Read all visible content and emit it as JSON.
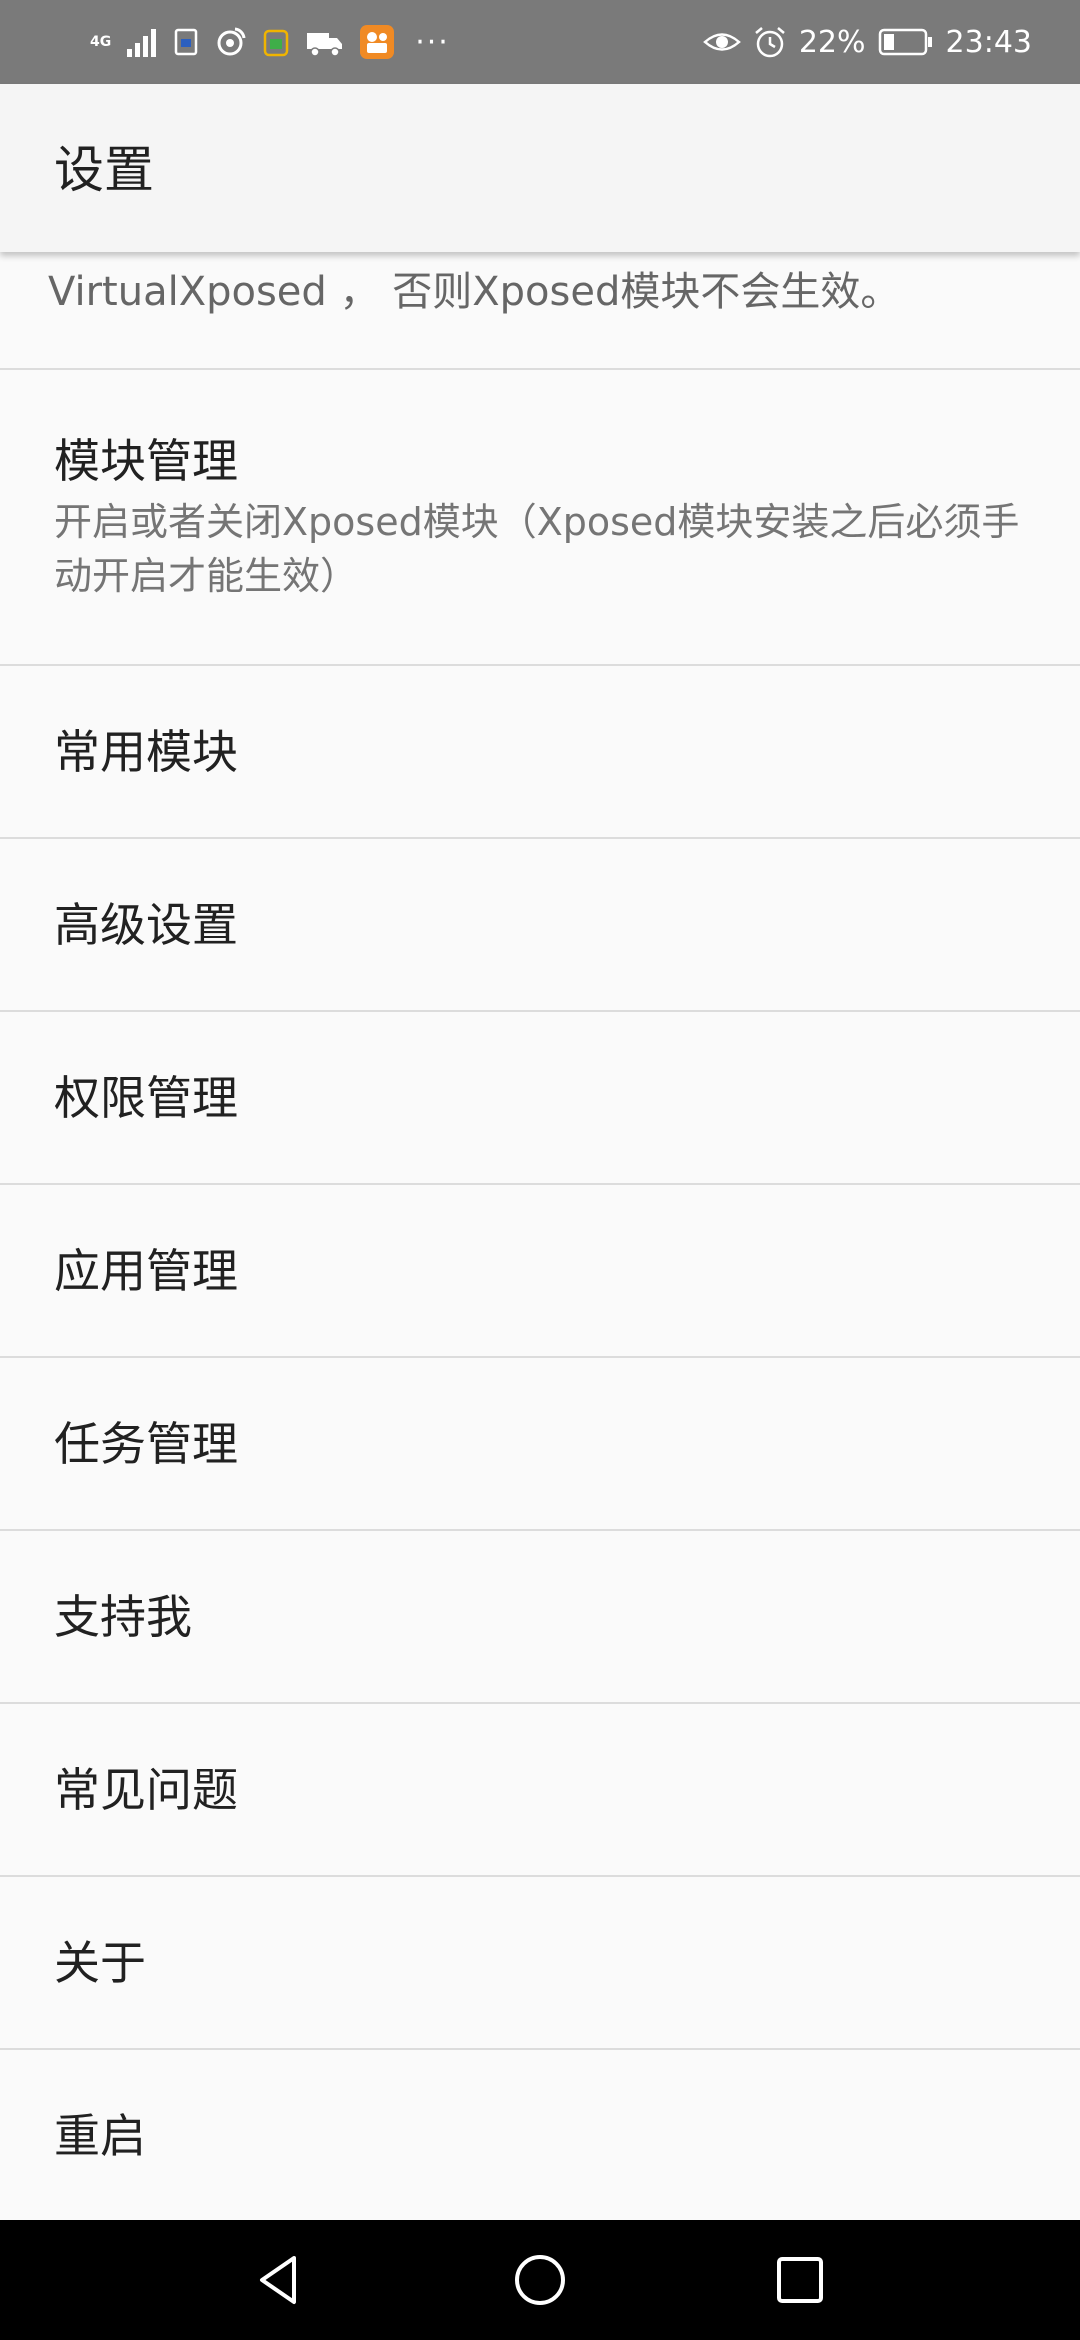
{
  "status_bar": {
    "network": "4G",
    "battery_percent": "22%",
    "time": "23:43",
    "more": "···",
    "left_icons": [
      "signal-icon",
      "sim-icon",
      "weibo-icon",
      "wechat-icon",
      "truck-icon",
      "video-app-icon"
    ],
    "right_icons": [
      "eye-icon",
      "alarm-icon",
      "battery-icon"
    ]
  },
  "app_bar": {
    "title": "设置"
  },
  "list": {
    "partial_item": {
      "summary": "VirtualXposed ， 否则Xposed模块不会生效。"
    },
    "items": [
      {
        "title": "模块管理",
        "summary": "开启或者关闭Xposed模块（Xposed模块安装之后必须手动开启才能生效）"
      },
      {
        "title": "常用模块"
      },
      {
        "title": "高级设置"
      },
      {
        "title": "权限管理"
      },
      {
        "title": "应用管理"
      },
      {
        "title": "任务管理"
      },
      {
        "title": "支持我"
      },
      {
        "title": "常见问题"
      },
      {
        "title": "关于"
      },
      {
        "title": "重启"
      }
    ]
  },
  "nav_bar": {
    "buttons": [
      "back-icon",
      "home-icon",
      "recents-icon"
    ]
  },
  "colors": {
    "status_bar_bg": "#7a7a7a",
    "app_bar_bg": "#f5f5f5",
    "list_bg": "#fafafa",
    "divider": "#dcdcdc",
    "nav_bar_bg": "#000000"
  }
}
